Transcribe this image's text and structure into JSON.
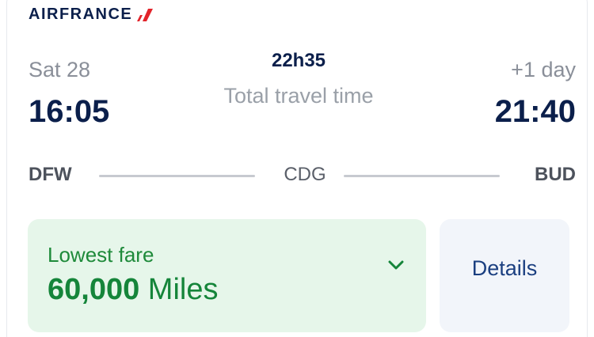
{
  "brand": {
    "name": "AIRFRANCE",
    "logo_icon": "airfrance-stripe-icon",
    "colors": {
      "navy": "#0b1f4b",
      "red": "#e2232a"
    }
  },
  "flight": {
    "departure": {
      "date": "Sat 28",
      "time": "16:05",
      "airport": "DFW"
    },
    "arrival": {
      "day_offset": "+1 day",
      "time": "21:40",
      "airport": "BUD"
    },
    "connection": {
      "airport": "CDG"
    },
    "duration": {
      "value": "22h35",
      "label": "Total travel time"
    }
  },
  "fare": {
    "label": "Lowest fare",
    "amount": "60,000",
    "unit": "Miles",
    "expand_icon": "chevron-down-icon",
    "colors": {
      "background": "#e6f6ea",
      "text": "#15853a"
    }
  },
  "details": {
    "label": "Details",
    "colors": {
      "background": "#f2f5fa",
      "text": "#1b3f80"
    }
  }
}
